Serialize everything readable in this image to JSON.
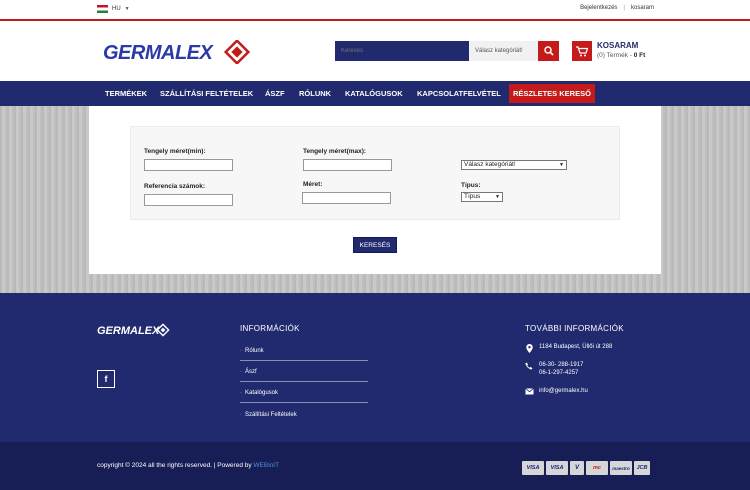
{
  "topbar": {
    "lang": "HU",
    "login": "Bejelentkezés",
    "sep": "|",
    "cart_link": "kosaram"
  },
  "header": {
    "logo_text": "GERMALEX",
    "search": {
      "placeholder": "Keresés",
      "category": "Válasz kategóriát!"
    },
    "cart": {
      "title": "KOSARAM",
      "count": "(0) Termék",
      "dash": " - ",
      "total": "0 Ft"
    }
  },
  "nav": {
    "items": [
      "TERMÉKEK",
      "SZÁLLÍTÁSI FELTÉTELEK",
      "ÁSZF",
      "RÓLUNK",
      "KATALÓGUSOK",
      "KAPCSOLATFELVÉTEL",
      "RÉSZLETES KERESŐ"
    ],
    "active_index": 6
  },
  "filters": {
    "shaft_min_label": "Tengely méret(min):",
    "shaft_max_label": "Tengely méret(max):",
    "category_select": "Válasz kategóriát!",
    "reference_label": "Referencia számok:",
    "size_label": "Méret:",
    "type_label": "Típus:",
    "type_select": "Típus",
    "submit": "KERESÉS"
  },
  "footer": {
    "info_title": "INFORMÁCIÓK",
    "links": [
      "Rólunk",
      "Ászf",
      "Katalógusok",
      "Szállítási Feltételek"
    ],
    "more_title": "TOVÁBBI INFORMÁCIÓK",
    "address": "1184 Budapest, Üllői út 288",
    "phone1": "06-30- 288-1917",
    "phone2": "06-1-297-4257",
    "email": "info@germalex.hu",
    "facebook": "f"
  },
  "bottom": {
    "copyright": "copyright © 2024 all the rights reserved. | Powered by ",
    "powered": "WEBinIT",
    "cards": [
      "VISA",
      "VISA",
      "V",
      "mc",
      "maestro",
      "JCB"
    ]
  },
  "colors": {
    "navy": "#212a6f",
    "red": "#c41a1a",
    "footer_dark": "#171e55"
  }
}
